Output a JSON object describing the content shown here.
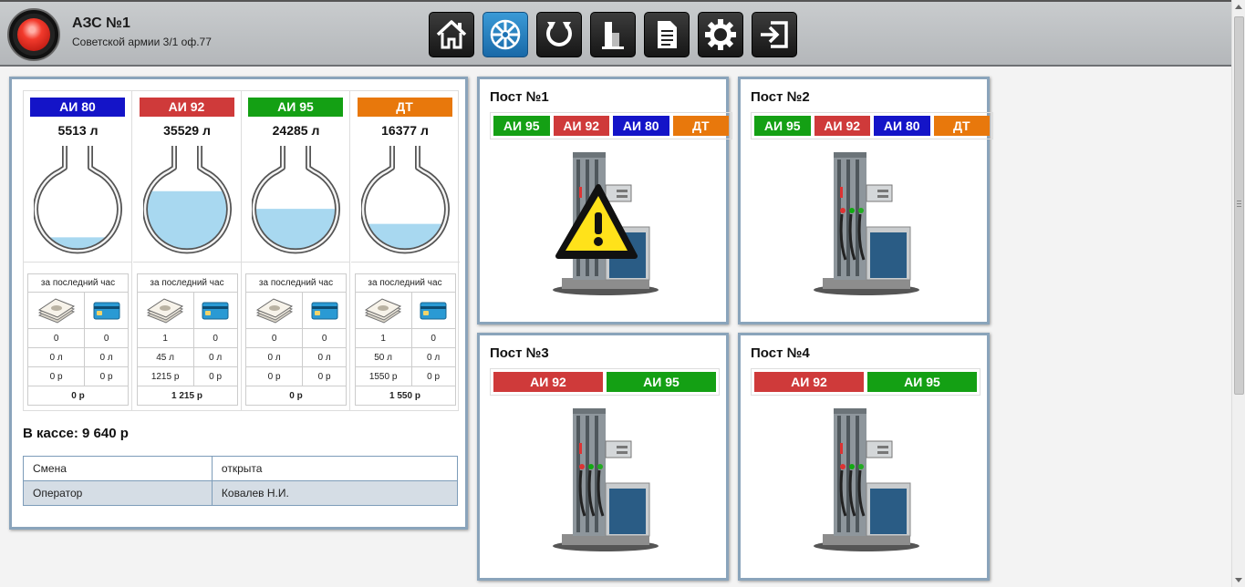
{
  "header": {
    "title": "АЗС №1",
    "address": "Советской армии 3/1 оф.77",
    "toolbar": [
      "home-icon",
      "snowflake-icon",
      "reset-icon",
      "fuel-tower-icon",
      "report-icon",
      "settings-icon",
      "logout-icon"
    ]
  },
  "colors": {
    "ai80": "#1414c8",
    "ai92": "#cf3a3a",
    "ai95": "#14a014",
    "dt": "#e8780c",
    "liquid": "#a8d8f0",
    "panel_border": "#8aa4bb"
  },
  "tanks": [
    {
      "fuel": "АИ 80",
      "color": "#1414c8",
      "volume": "5513 л",
      "level": 0.17,
      "sales": {
        "header": "за последний час",
        "count": [
          "0",
          "0"
        ],
        "liters": [
          "0 л",
          "0 л"
        ],
        "sum": [
          "0 р",
          "0 р"
        ],
        "total": "0 р"
      }
    },
    {
      "fuel": "АИ 92",
      "color": "#cf3a3a",
      "volume": "35529 л",
      "level": 0.72,
      "sales": {
        "header": "за последний час",
        "count": [
          "1",
          "0"
        ],
        "liters": [
          "45 л",
          "0 л"
        ],
        "sum": [
          "1215 р",
          "0 р"
        ],
        "total": "1 215 р"
      }
    },
    {
      "fuel": "АИ 95",
      "color": "#14a014",
      "volume": "24285 л",
      "level": 0.51,
      "sales": {
        "header": "за последний час",
        "count": [
          "0",
          "0"
        ],
        "liters": [
          "0 л",
          "0 л"
        ],
        "sum": [
          "0 р",
          "0 р"
        ],
        "total": "0 р"
      }
    },
    {
      "fuel": "ДТ",
      "color": "#e8780c",
      "volume": "16377 л",
      "level": 0.33,
      "sales": {
        "header": "за последний час",
        "count": [
          "1",
          "0"
        ],
        "liters": [
          "50 л",
          "0 л"
        ],
        "sum": [
          "1550 р",
          "0 р"
        ],
        "total": "1 550 р"
      }
    }
  ],
  "cashbox": "В кассе: 9 640 р",
  "shift_table": [
    {
      "label": "Смена",
      "value": "открыта"
    },
    {
      "label": "Оператор",
      "value": "Ковалев Н.И."
    }
  ],
  "posts": [
    {
      "title": "Пост №1",
      "warning": true,
      "grades": [
        {
          "name": "АИ 95",
          "color": "#14a014"
        },
        {
          "name": "АИ 92",
          "color": "#cf3a3a"
        },
        {
          "name": "АИ 80",
          "color": "#1414c8"
        },
        {
          "name": "ДТ",
          "color": "#e8780c"
        }
      ]
    },
    {
      "title": "Пост №2",
      "warning": false,
      "grades": [
        {
          "name": "АИ 95",
          "color": "#14a014"
        },
        {
          "name": "АИ 92",
          "color": "#cf3a3a"
        },
        {
          "name": "АИ 80",
          "color": "#1414c8"
        },
        {
          "name": "ДТ",
          "color": "#e8780c"
        }
      ]
    },
    {
      "title": "Пост №3",
      "warning": false,
      "grades": [
        {
          "name": "АИ 92",
          "color": "#cf3a3a"
        },
        {
          "name": "АИ 95",
          "color": "#14a014"
        }
      ]
    },
    {
      "title": "Пост №4",
      "warning": false,
      "grades": [
        {
          "name": "АИ 92",
          "color": "#cf3a3a"
        },
        {
          "name": "АИ 95",
          "color": "#14a014"
        }
      ]
    }
  ]
}
